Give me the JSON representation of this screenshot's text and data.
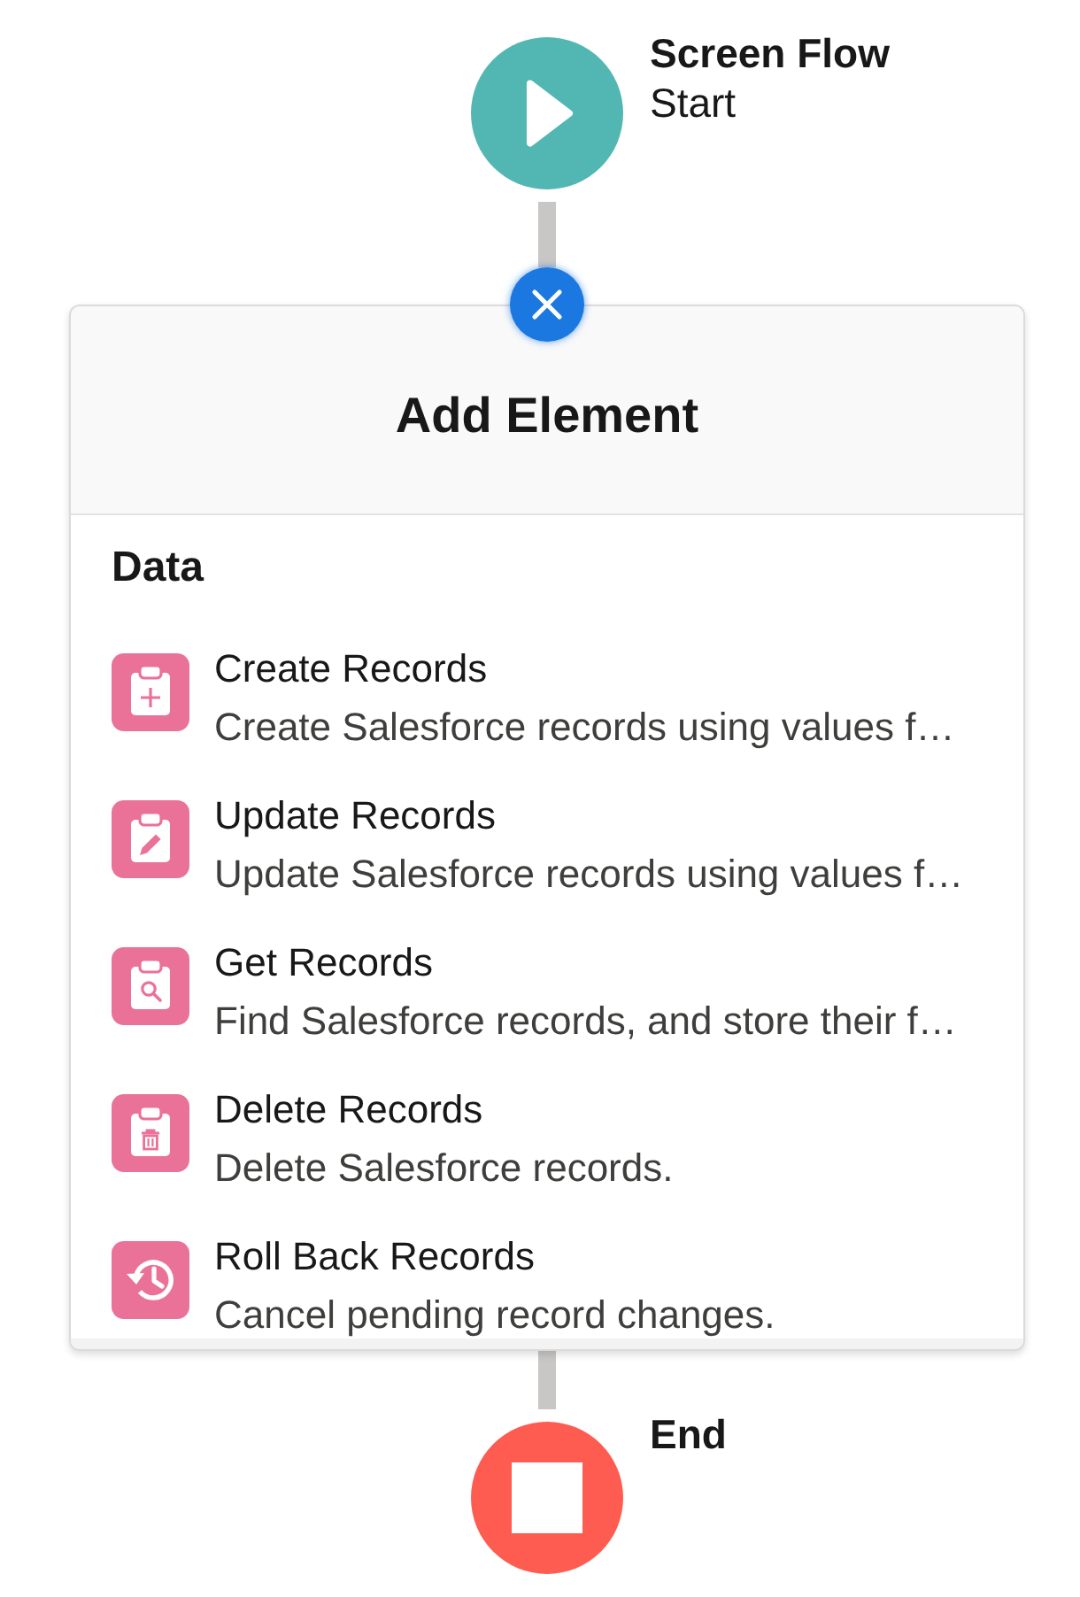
{
  "start_node": {
    "title": "Screen Flow",
    "subtitle": "Start"
  },
  "panel": {
    "title": "Add Element",
    "section": "Data",
    "items": [
      {
        "kind": "create",
        "title": "Create Records",
        "description": "Create Salesforce records using values f…"
      },
      {
        "kind": "update",
        "title": "Update Records",
        "description": "Update Salesforce records using values f…"
      },
      {
        "kind": "get",
        "title": "Get Records",
        "description": "Find Salesforce records, and store their f…"
      },
      {
        "kind": "delete",
        "title": "Delete Records",
        "description": "Delete Salesforce records."
      },
      {
        "kind": "rollback",
        "title": "Roll Back Records",
        "description": "Cancel pending record changes."
      }
    ]
  },
  "end_node": {
    "title": "End"
  }
}
